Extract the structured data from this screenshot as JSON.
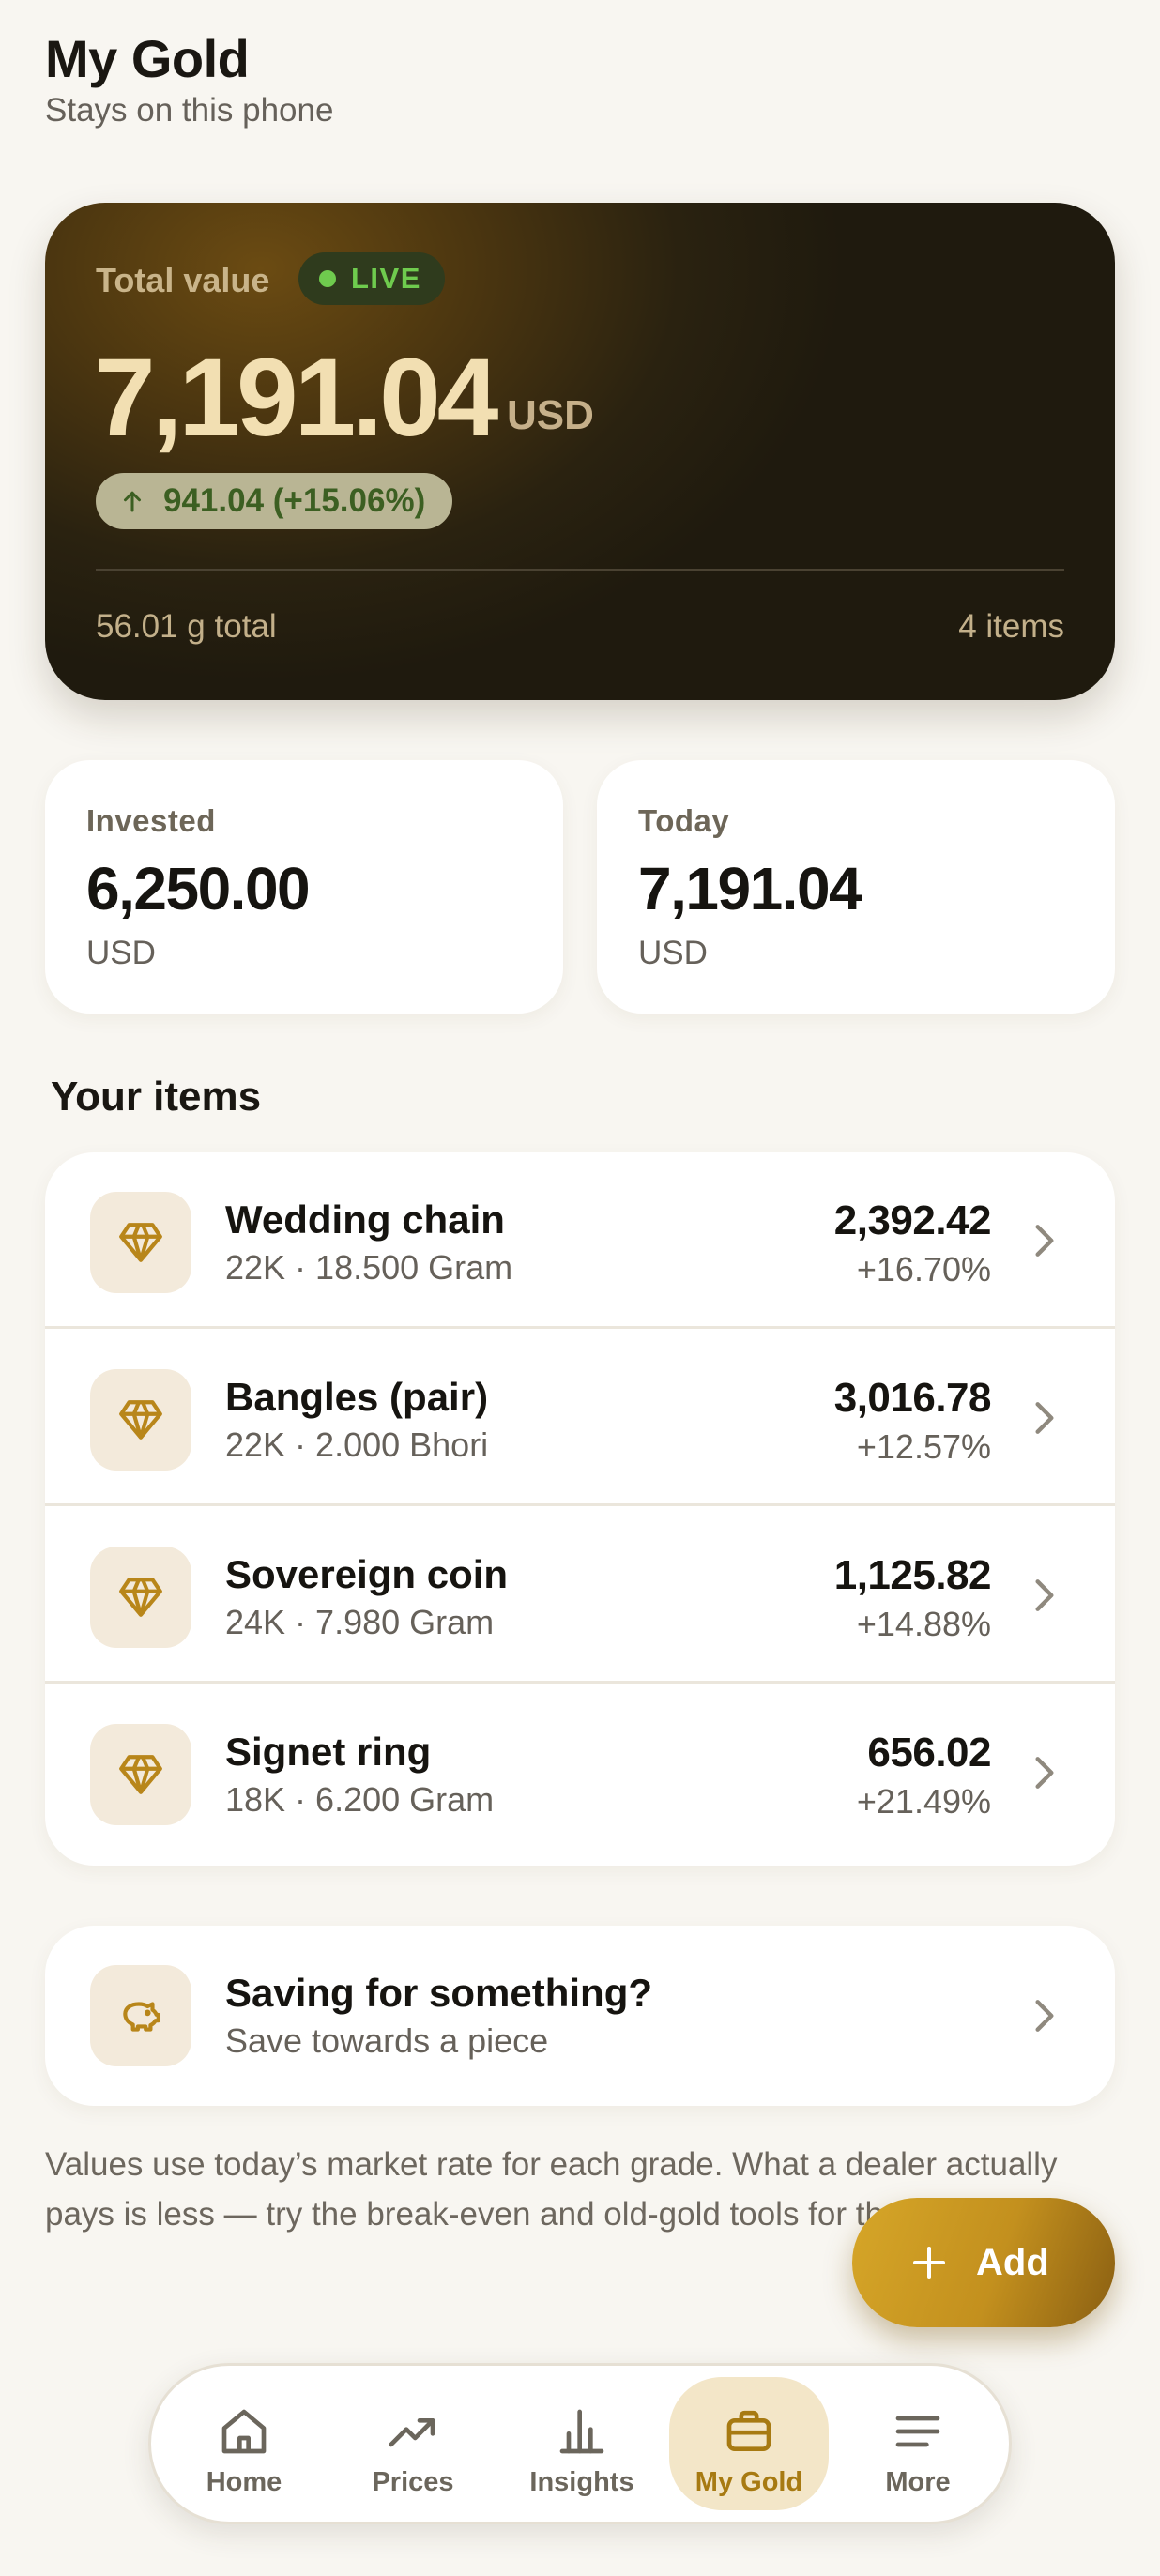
{
  "header": {
    "title": "My Gold",
    "subtitle": "Stays on this phone"
  },
  "hero": {
    "label": "Total value",
    "live_badge": "LIVE",
    "amount": "7,191.04",
    "currency": "USD",
    "change": "941.04 (+15.06%)",
    "total_weight": "56.01 g total",
    "item_count": "4 items",
    "colors": {
      "live": "#6fcb4e",
      "amount": "#f2dfb2",
      "change": "#3c5f22"
    }
  },
  "summary": {
    "invested": {
      "label": "Invested",
      "value": "6,250.00",
      "unit": "USD"
    },
    "today": {
      "label": "Today",
      "value": "7,191.04",
      "unit": "USD"
    }
  },
  "items_section": {
    "title": "Your items",
    "items": [
      {
        "name": "Wedding chain",
        "meta": "22K · 18.500 Gram",
        "value": "2,392.42",
        "change": "+16.70%",
        "icon": "gem-icon"
      },
      {
        "name": "Bangles (pair)",
        "meta": "22K · 2.000 Bhori",
        "value": "3,016.78",
        "change": "+12.57%",
        "icon": "gem-icon"
      },
      {
        "name": "Sovereign coin",
        "meta": "24K · 7.980 Gram",
        "value": "1,125.82",
        "change": "+14.88%",
        "icon": "gem-icon"
      },
      {
        "name": "Signet ring",
        "meta": "18K · 6.200 Gram",
        "value": "656.02",
        "change": "+21.49%",
        "icon": "gem-icon"
      }
    ]
  },
  "saving": {
    "title": "Saving for something?",
    "subtitle": "Save towards a piece",
    "icon": "piggy-bank-icon"
  },
  "footnote": "Values use today’s market rate for each grade. What a dealer actually pays is less — try the break-even and old-gold tools for that.",
  "fab": {
    "label": "Add",
    "icon": "plus-icon"
  },
  "nav": {
    "active": "My Gold",
    "items": [
      {
        "label": "Home",
        "icon": "home-icon"
      },
      {
        "label": "Prices",
        "icon": "trending-up-icon"
      },
      {
        "label": "Insights",
        "icon": "bar-chart-icon"
      },
      {
        "label": "My Gold",
        "icon": "briefcase-icon"
      },
      {
        "label": "More",
        "icon": "menu-icon"
      }
    ]
  },
  "theme": {
    "accent": "#c3901e",
    "background": "#f8f6f1",
    "card": "#ffffff"
  }
}
